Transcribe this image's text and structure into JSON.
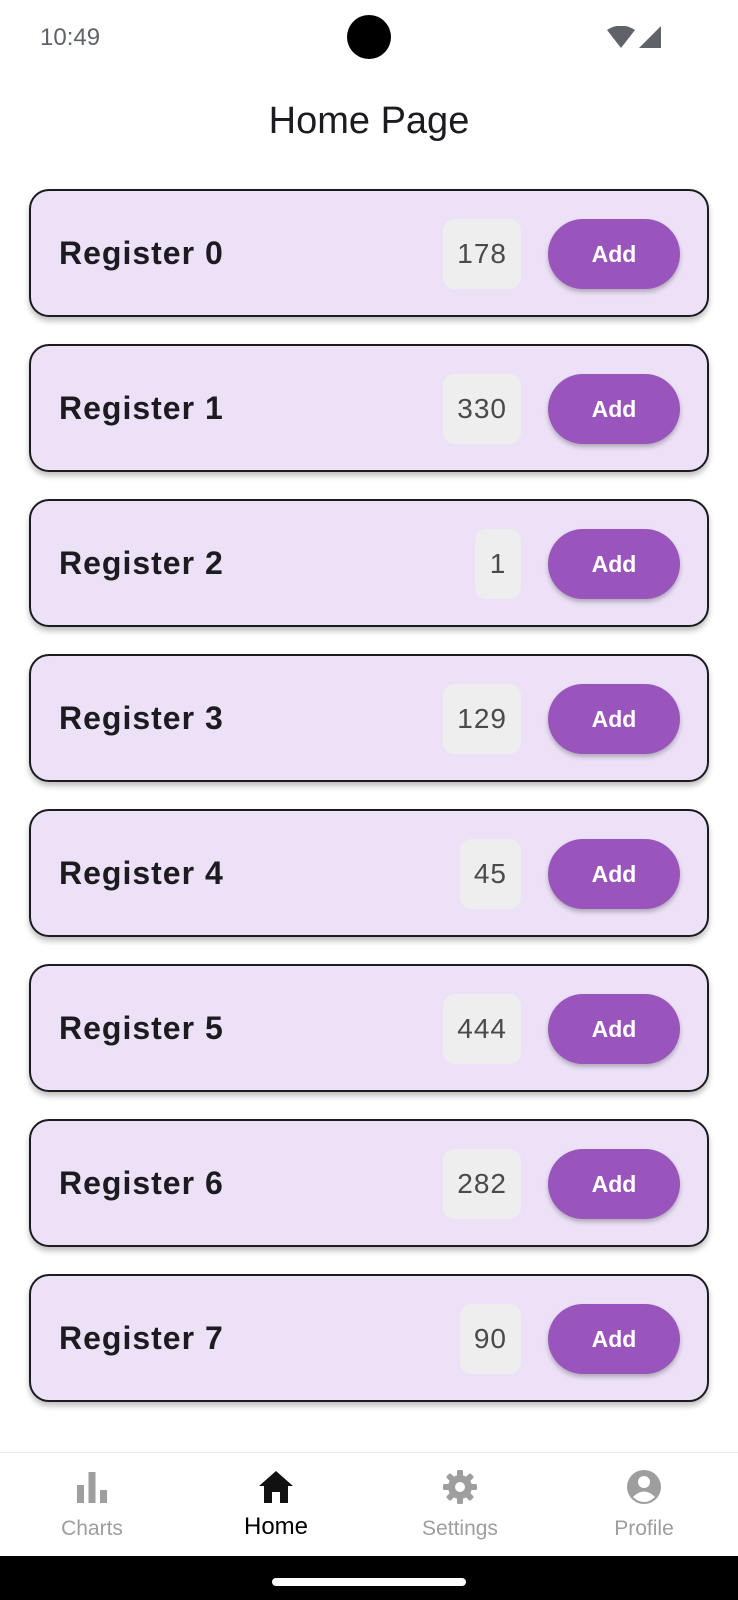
{
  "status_bar": {
    "time": "10:49"
  },
  "page_title": "Home Page",
  "registers": [
    {
      "name": "Register 0",
      "count": "178",
      "button_label": "Add"
    },
    {
      "name": "Register 1",
      "count": "330",
      "button_label": "Add"
    },
    {
      "name": "Register 2",
      "count": "1",
      "button_label": "Add"
    },
    {
      "name": "Register 3",
      "count": "129",
      "button_label": "Add"
    },
    {
      "name": "Register 4",
      "count": "45",
      "button_label": "Add"
    },
    {
      "name": "Register 5",
      "count": "444",
      "button_label": "Add"
    },
    {
      "name": "Register 6",
      "count": "282",
      "button_label": "Add"
    },
    {
      "name": "Register 7",
      "count": "90",
      "button_label": "Add"
    }
  ],
  "bottom_nav": {
    "items": [
      {
        "label": "Charts",
        "icon": "bar-chart-icon",
        "active": false
      },
      {
        "label": "Home",
        "icon": "home-icon",
        "active": true
      },
      {
        "label": "Settings",
        "icon": "gear-icon",
        "active": false
      },
      {
        "label": "Profile",
        "icon": "account-circle-icon",
        "active": false
      }
    ]
  },
  "colors": {
    "card_background": "#ede1f8",
    "accent": "#9955bb",
    "count_background": "#eeeeee",
    "inactive_nav": "#9e9e9e"
  }
}
